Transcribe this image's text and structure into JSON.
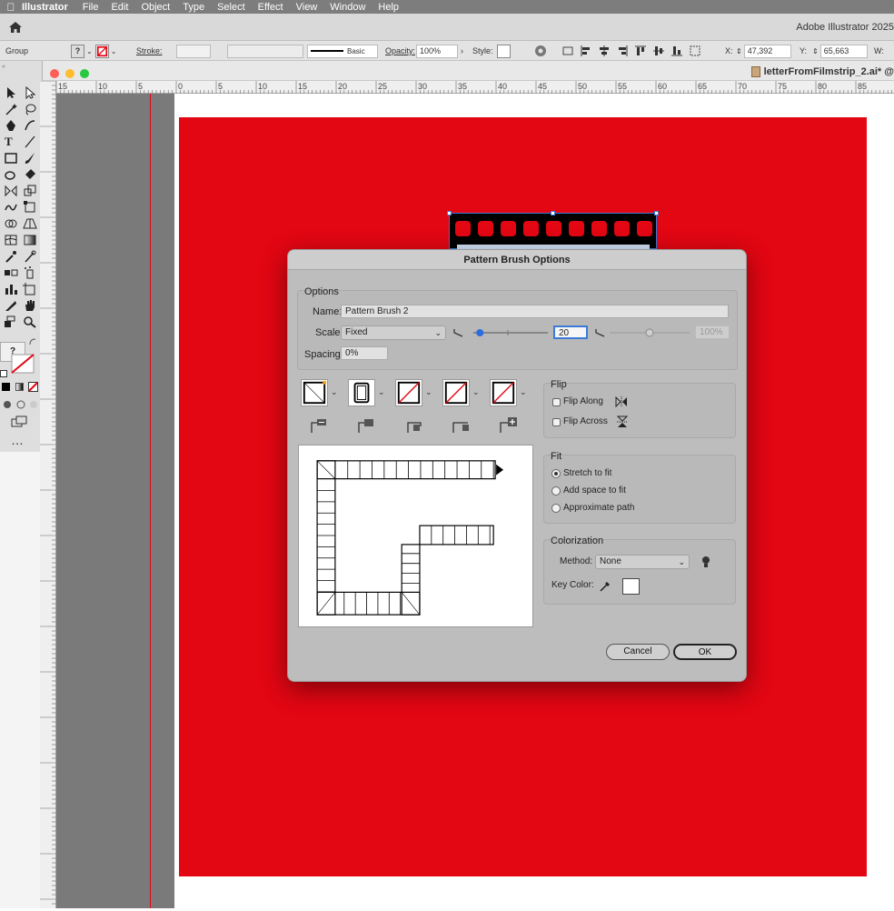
{
  "menubar": {
    "app": "Illustrator",
    "items": [
      "File",
      "Edit",
      "Object",
      "Type",
      "Select",
      "Effect",
      "View",
      "Window",
      "Help"
    ]
  },
  "appbar": {
    "title": "Adobe Illustrator 2025"
  },
  "control": {
    "selection": "Group",
    "stroke_label": "Stroke:",
    "brush_label": "Basic",
    "opacity_label": "Opacity:",
    "opacity_value": "100%",
    "style_label": "Style:",
    "x_label": "X:",
    "x_value": "47,392 mm",
    "y_label": "Y:",
    "y_value": "65,663 mm",
    "w_label": "W:"
  },
  "document": {
    "title": "letterFromFilmstrip_2.ai* @"
  },
  "ruler": {
    "ticks": [
      "15",
      "10",
      "5",
      "0",
      "5",
      "10",
      "15",
      "20",
      "25",
      "30",
      "35",
      "40",
      "45",
      "50",
      "55",
      "60",
      "65",
      "70",
      "75",
      "80",
      "85"
    ]
  },
  "dialog": {
    "title": "Pattern Brush Options",
    "options_group": "Options",
    "name_label": "Name:",
    "name_value": "Pattern Brush 2",
    "scale_label": "Scale:",
    "scale_mode": "Fixed",
    "scale_value": "20",
    "scale_max": "100%",
    "scale_fraction": 0.2,
    "spacing_label": "Spacing:",
    "spacing_value": "0%",
    "flip_group": "Flip",
    "flip_along": "Flip Along",
    "flip_across": "Flip Across",
    "fit_group": "Fit",
    "fit_options": [
      "Stretch to fit",
      "Add space to fit",
      "Approximate path"
    ],
    "fit_selected": "Stretch to fit",
    "colorization_group": "Colorization",
    "method_label": "Method:",
    "method_value": "None",
    "key_color_label": "Key Color:",
    "cancel": "Cancel",
    "ok": "OK"
  },
  "colors": {
    "artboard": "#e30613",
    "selection": "#3a7bd5",
    "dialog": "#bdbdbd"
  }
}
